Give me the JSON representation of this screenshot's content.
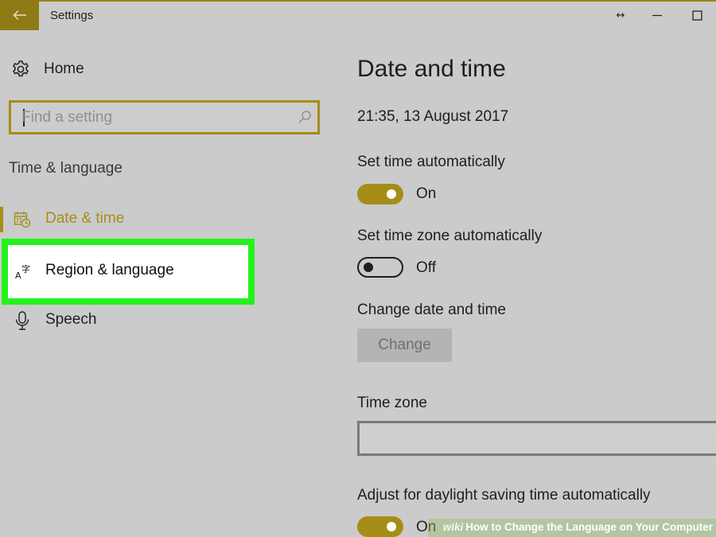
{
  "titlebar": {
    "title": "Settings",
    "resize_glyph": "↔",
    "icons": {
      "back": "back-arrow-icon",
      "minimize": "minimize-icon",
      "maximize": "maximize-icon"
    }
  },
  "sidebar": {
    "home_label": "Home",
    "search": {
      "placeholder": "Find a setting",
      "icon": "search-icon"
    },
    "section_heading": "Time & language",
    "items": [
      {
        "label": "Date & time",
        "icon": "calendar-clock-icon",
        "selected": true
      },
      {
        "label": "Region & language",
        "icon": "language-icon",
        "highlighted": true
      },
      {
        "label": "Speech",
        "icon": "microphone-icon"
      }
    ]
  },
  "main": {
    "title": "Date and time",
    "current_datetime": "21:35, 13 August 2017",
    "set_time_auto": {
      "label": "Set time automatically",
      "state": "On"
    },
    "set_timezone_auto": {
      "label": "Set time zone automatically",
      "state": "Off"
    },
    "change_date_time": {
      "label": "Change date and time",
      "button": "Change"
    },
    "time_zone": {
      "label": "Time zone",
      "value": ""
    },
    "daylight_saving": {
      "label": "Adjust for daylight saving time automatically",
      "state": "On"
    }
  },
  "watermark": {
    "brand": "wiki",
    "text": "How to Change the Language on Your Computer"
  },
  "colors": {
    "accent": "#a58d18",
    "background": "#cbcbcb",
    "highlight_border": "#24f21c",
    "back_button": "#8f7a16"
  }
}
